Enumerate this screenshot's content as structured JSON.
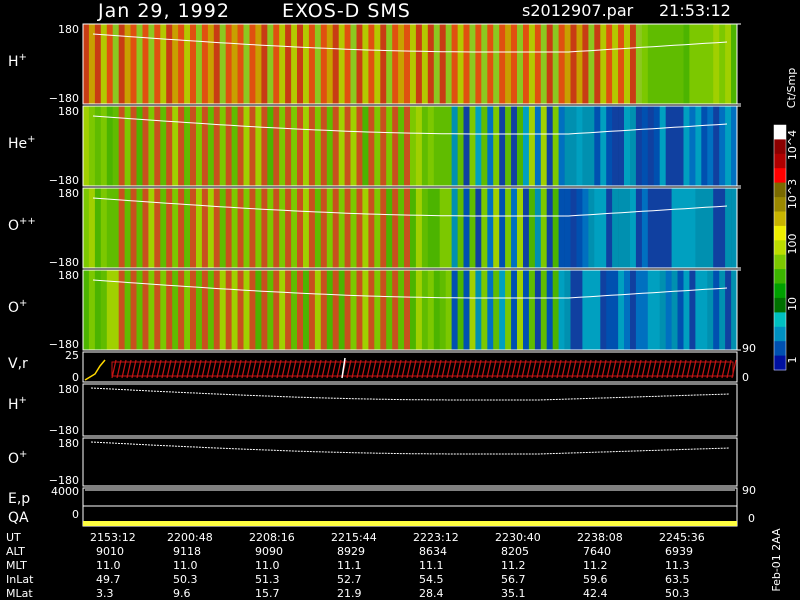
{
  "header": {
    "date": "Jan 29, 1992",
    "instrument": "EXOS-D SMS",
    "file": "s2012907.par",
    "time": "21:53:12"
  },
  "chart_data": {
    "type": "heatmap",
    "panels": [
      {
        "id": "h",
        "label_base": "H",
        "label_sup": "+",
        "ytop": "180",
        "ybot": "−180"
      },
      {
        "id": "he",
        "label_base": "He",
        "label_sup": "+",
        "ytop": "180",
        "ybot": "−180"
      },
      {
        "id": "opp",
        "label_base": "O",
        "label_sup": "++",
        "ytop": "180",
        "ybot": "−180"
      },
      {
        "id": "op",
        "label_base": "O",
        "label_sup": "+",
        "ytop": "180",
        "ybot": "−180"
      }
    ],
    "vr_panel": {
      "label": "V,r",
      "ytop": "25",
      "ybot": "0",
      "right_top": "90",
      "right_bot": "0"
    },
    "line_panels": [
      {
        "label_base": "H",
        "label_sup": "+",
        "ytop": "180",
        "ybot": "−180"
      },
      {
        "label_base": "O",
        "label_sup": "+",
        "ytop": "180",
        "ybot": "−180"
      }
    ],
    "ep_panel": {
      "label": "E,p",
      "ytick": "4000",
      "right": "90"
    },
    "qa_panel": {
      "label": "QA",
      "ytick": "0",
      "right": "0"
    },
    "colorbar": {
      "unit": "Ct/Smp",
      "ticks": [
        "10^4",
        "10^3",
        "100",
        "10",
        "1"
      ],
      "colors": [
        "#ffffff",
        "#8b0000",
        "#b00000",
        "#ff0000",
        "#7a6a00",
        "#9a8800",
        "#c8b400",
        "#f0f000",
        "#bcdc00",
        "#7cc800",
        "#3cb400",
        "#00a000",
        "#007000",
        "#00c0c0",
        "#0090c0",
        "#0050b0",
        "#0010a0"
      ]
    },
    "time_axis": {
      "rows": [
        "UT",
        "ALT",
        "MLT",
        "InLat",
        "MLat"
      ],
      "columns": [
        {
          "UT": "2153:12",
          "ALT": "9010",
          "MLT": "11.0",
          "InLat": "49.7",
          "MLat": "3.3"
        },
        {
          "UT": "2200:48",
          "ALT": "9118",
          "MLT": "11.0",
          "InLat": "50.3",
          "MLat": "9.6"
        },
        {
          "UT": "2208:16",
          "ALT": "9090",
          "MLT": "11.0",
          "InLat": "51.3",
          "MLat": "15.7"
        },
        {
          "UT": "2215:44",
          "ALT": "8929",
          "MLT": "11.1",
          "InLat": "52.7",
          "MLat": "21.9"
        },
        {
          "UT": "2223:12",
          "ALT": "8634",
          "MLT": "11.1",
          "InLat": "54.5",
          "MLat": "28.4"
        },
        {
          "UT": "2230:40",
          "ALT": "8205",
          "MLT": "11.2",
          "InLat": "56.7",
          "MLat": "35.1"
        },
        {
          "UT": "2238:08",
          "ALT": "7640",
          "MLT": "11.2",
          "InLat": "59.6",
          "MLat": "42.4"
        },
        {
          "UT": "2245:36",
          "ALT": "6939",
          "MLT": "11.3",
          "InLat": "63.5",
          "MLat": "50.3"
        }
      ]
    },
    "footer_side": "Feb-01 2AA"
  }
}
